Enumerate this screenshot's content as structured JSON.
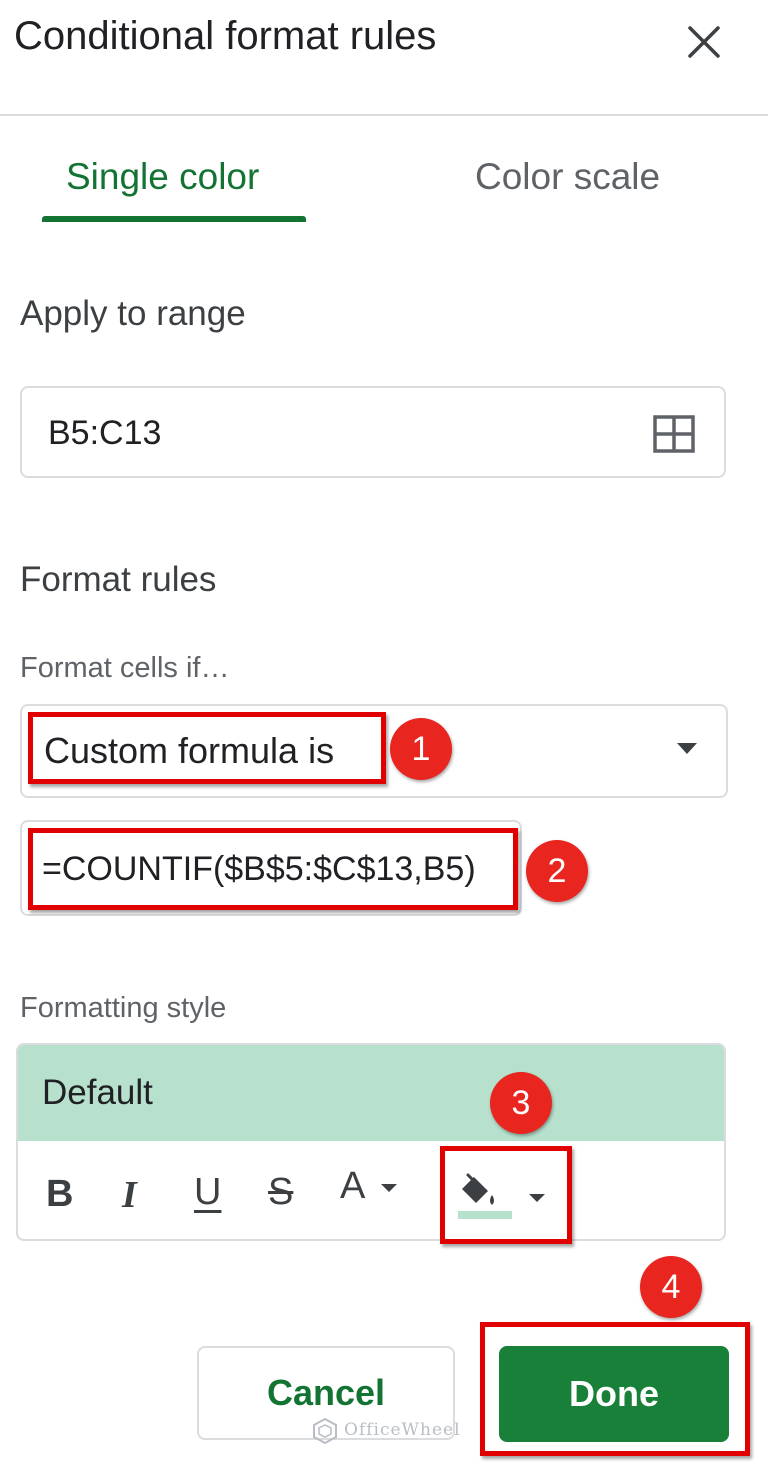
{
  "panel": {
    "title": "Conditional format rules",
    "close_icon": "close-icon"
  },
  "tabs": [
    {
      "label": "Single color",
      "active": true
    },
    {
      "label": "Color scale",
      "active": false
    }
  ],
  "apply_range": {
    "heading": "Apply to range",
    "value": "B5:C13",
    "icon": "grid-select-icon"
  },
  "format_rules": {
    "heading": "Format rules",
    "condition_label": "Format cells if…",
    "condition_value": "Custom formula is",
    "formula_value": "=COUNTIF($B$5:$C$13,B5)"
  },
  "formatting_style": {
    "label": "Formatting style",
    "preset": "Default",
    "preview_color": "#b7e1cd",
    "toolbar": [
      {
        "name": "bold",
        "glyph": "B"
      },
      {
        "name": "italic",
        "glyph": "I"
      },
      {
        "name": "underline",
        "glyph": "U"
      },
      {
        "name": "strikethrough",
        "glyph": "S"
      },
      {
        "name": "text-color",
        "glyph": "A"
      },
      {
        "name": "fill-color",
        "icon": "paint-bucket-icon"
      }
    ]
  },
  "actions": {
    "cancel_label": "Cancel",
    "done_label": "Done"
  },
  "annotations": [
    "1",
    "2",
    "3",
    "4"
  ],
  "watermark": "OfficeWheel",
  "colors": {
    "accent_green": "#137333",
    "done_button": "#188038",
    "highlight_red": "#e00000",
    "badge_red": "#e8251f"
  }
}
